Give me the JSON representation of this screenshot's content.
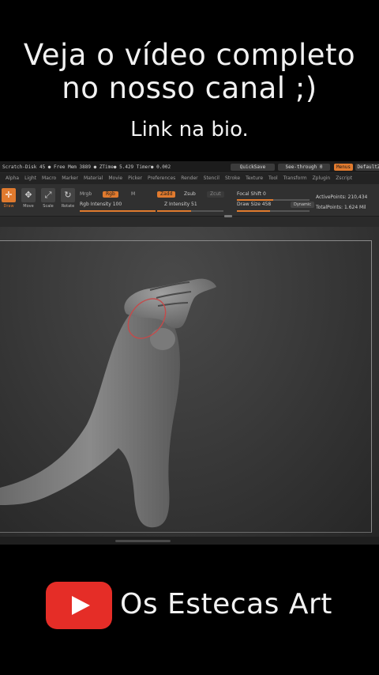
{
  "overlay": {
    "headline_line1": "Veja o vídeo completo",
    "headline_line2": "no nosso canal ;)",
    "subline": "Link na bio.",
    "channel_name": "Os Estecas Art",
    "brand_icon": "youtube-logo-icon",
    "brand_color": "#e52d27"
  },
  "app": {
    "title_stats": "Scratch-Disk 45 ● Free Mem 3889 ● ZTime● 5.429 Timer● 0.002",
    "quicksave_label": "QuickSave",
    "seethrough_label": "See-through  0",
    "menus_label": "Menus",
    "default_label": "DefaultZ",
    "menu_items": [
      "Alpha",
      "Light",
      "Macro",
      "Marker",
      "Material",
      "Movie",
      "Picker",
      "Preferences",
      "Render",
      "Stencil",
      "Stroke",
      "Texture",
      "Tool",
      "Transform",
      "Zplugin",
      "Zscript"
    ],
    "tools": [
      {
        "label": "Draw",
        "icon": "draw-icon",
        "active": true
      },
      {
        "label": "Move",
        "icon": "move-icon",
        "active": false
      },
      {
        "label": "Scale",
        "icon": "scale-icon",
        "active": false
      },
      {
        "label": "Rotate",
        "icon": "rotate-icon",
        "active": false
      }
    ],
    "mrgb_label": "Mrgb",
    "rgb_label": "Rgb",
    "m_label": "M",
    "zadd_label": "Zadd",
    "zsub_label": "Zsub",
    "zcut_label": "Zcut",
    "rgb_intensity_label": "Rgb  Intensity 100",
    "z_intensity_label": "Z Intensity 51",
    "focal_shift_label": "Focal Shift 0",
    "draw_size_label": "Draw Size 458",
    "dynamic_label": "Dynamic",
    "active_points_label": "ActivePoints: 210,434",
    "total_points_label": "TotalPoints: 1.624 Mil",
    "rgb_intensity": 1.0,
    "z_intensity": 0.51,
    "focal_shift": 0.5,
    "draw_size": 0.46,
    "accent_color": "#e07a2e"
  }
}
